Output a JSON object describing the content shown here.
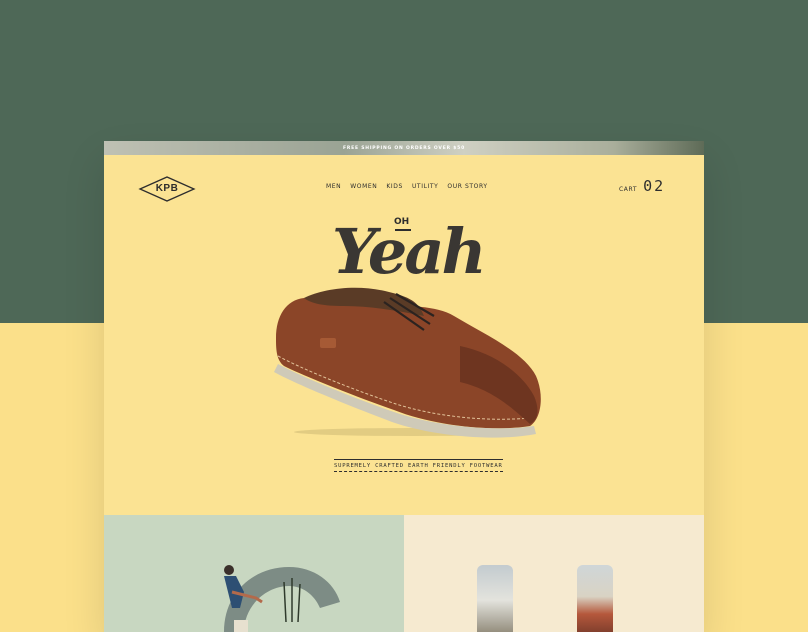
{
  "announcement": "FREE SHIPPING ON ORDERS OVER $50",
  "logo": {
    "text": "KPB"
  },
  "nav": {
    "items": [
      {
        "label": "MEN"
      },
      {
        "label": "WOMEN"
      },
      {
        "label": "KIDS"
      },
      {
        "label": "UTILITY"
      },
      {
        "label": "OUR STORY"
      }
    ]
  },
  "cart": {
    "label": "CART",
    "count": "02"
  },
  "hero": {
    "oh": "OH",
    "yeah": "Yeah",
    "tagline": "SUPREMELY CRAFTED EARTH FRIENDLY FOOTWEAR"
  },
  "colors": {
    "background_top": "#4e6857",
    "background_bottom": "#fbe08a",
    "page": "#fbe393",
    "accent_text": "#2e2e2e",
    "shoe_leather": "#8b4528"
  },
  "icons": [
    "diamond-logo-icon",
    "shoe-image",
    "yoga-figure-image",
    "canyon-thumbnail-image"
  ]
}
